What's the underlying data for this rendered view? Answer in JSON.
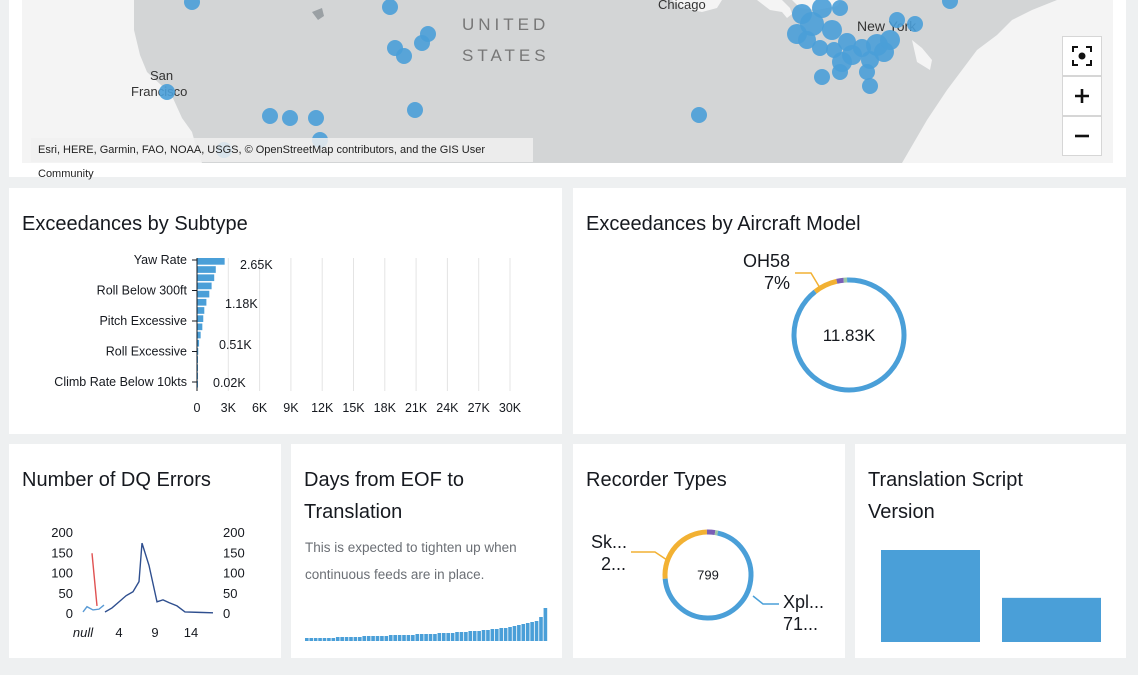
{
  "map": {
    "labels": {
      "chicago": "Chicago",
      "new_york": "New York",
      "united": "UNITED",
      "states": "STATES",
      "san": "San",
      "francisco": "Francisco"
    },
    "attribution": "Esri, HERE, Garmin, FAO, NOAA, USGS, © OpenStreetMap contributors, and the GIS User Community",
    "controls": [
      "focus-icon",
      "plus-icon",
      "minus-icon"
    ],
    "colors": {
      "land": "#d3d5d6",
      "water": "#f4f4f4",
      "marker": "#4a9fd8"
    }
  },
  "subtype_panel": {
    "title": "Exceedances by Subtype",
    "chart_data": {
      "type": "bar",
      "orientation": "horizontal",
      "categories": [
        "Yaw Rate",
        "Roll Below 300ft",
        "Pitch Excessive",
        "Roll Excessive",
        "Climb Rate Below 10kts"
      ],
      "bar_values": [
        2650,
        1800,
        1650,
        1400,
        1180,
        900,
        700,
        600,
        510,
        350,
        200,
        120,
        60,
        40,
        30,
        20
      ],
      "data_labels": [
        "2.65K",
        "1.18K",
        "0.51K",
        "0.02K"
      ],
      "x_ticks": [
        "0",
        "3K",
        "6K",
        "9K",
        "12K",
        "15K",
        "18K",
        "21K",
        "24K",
        "27K",
        "30K"
      ],
      "xlim": [
        0,
        30000
      ],
      "grid": true,
      "color": "#4a9fd8"
    }
  },
  "aircraft_panel": {
    "title": "Exceedances by Aircraft Model",
    "callout": {
      "name": "OH58",
      "pct": "7%"
    },
    "chart_data": {
      "type": "pie",
      "total_label": "11.83K",
      "slices": [
        {
          "label": "OH58",
          "fraction": 0.07,
          "color": "#f2b133"
        },
        {
          "label": "",
          "fraction": 0.02,
          "color": "#7b5fb5"
        },
        {
          "label": "",
          "fraction": 0.01,
          "color": "#9bc7a6"
        },
        {
          "label": "",
          "fraction": 0.9,
          "color": "#4a9fd8"
        }
      ]
    }
  },
  "dq_panel": {
    "title": "Number of DQ Errors",
    "chart_data": {
      "type": "line",
      "x_ticks": [
        "null",
        "4",
        "9",
        "14"
      ],
      "y_ticks": [
        "200",
        "150",
        "100",
        "50",
        "0"
      ],
      "ylim": [
        0,
        200
      ],
      "series": [
        {
          "color": "#e05252",
          "values": [
            150,
            20
          ]
        },
        {
          "color": "#5a9bd5",
          "values": [
            5,
            18,
            10,
            12,
            22
          ]
        },
        {
          "color": "#2f4f8f",
          "values": [
            5,
            15,
            30,
            45,
            55,
            80,
            175,
            120,
            30,
            35,
            28,
            20,
            5,
            4,
            3
          ]
        }
      ]
    }
  },
  "eof_panel": {
    "title_line1": "Days from EOF to",
    "title_line2": "Translation",
    "subtitle_line1": "This is expected to tighten up when",
    "subtitle_line2": "continuous feeds are in place.",
    "chart_data": {
      "type": "bar",
      "values": [
        3,
        3,
        3,
        3,
        3,
        3,
        3,
        4,
        4,
        4,
        4,
        4,
        4,
        5,
        5,
        5,
        5,
        5,
        5,
        6,
        6,
        6,
        6,
        6,
        6,
        7,
        7,
        7,
        7,
        7,
        8,
        8,
        8,
        8,
        9,
        9,
        9,
        10,
        10,
        10,
        11,
        11,
        12,
        12,
        13,
        13,
        14,
        15,
        16,
        17,
        18,
        19,
        20,
        24,
        33
      ],
      "color": "#4a9fd8"
    }
  },
  "recorder_panel": {
    "title": "Recorder Types",
    "callouts": {
      "left_line1": "Sk...",
      "left_line2": "2...",
      "right_line1": "Xpl...",
      "right_line2": "71..."
    },
    "chart_data": {
      "type": "pie",
      "total_label": "799",
      "slices": [
        {
          "label": "Sk...",
          "fraction": 0.26,
          "color": "#f2b133"
        },
        {
          "label": "",
          "fraction": 0.03,
          "color": "#7b5fb5"
        },
        {
          "label": "",
          "fraction": 0.01,
          "color": "#9bc7a6"
        },
        {
          "label": "Xpl...",
          "fraction": 0.7,
          "color": "#4a9fd8"
        }
      ]
    }
  },
  "script_panel": {
    "title_line1": "Translation Script",
    "title_line2": "Version",
    "chart_data": {
      "type": "bar",
      "values": [
        100,
        48
      ],
      "color": "#4a9fd8"
    }
  }
}
